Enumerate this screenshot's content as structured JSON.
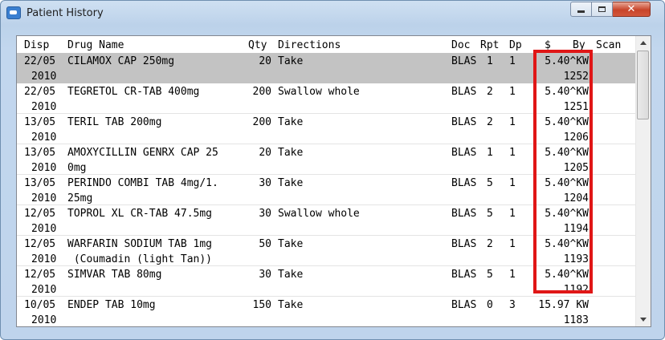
{
  "window": {
    "title": "Patient History",
    "icon": "app-icon",
    "controls": {
      "minimize": "minimize-icon",
      "maximize": "maximize-icon",
      "close_glyph": "✕"
    }
  },
  "table": {
    "headers": {
      "disp": "Disp",
      "drug": "Drug Name",
      "qty": "Qty",
      "directions": "Directions",
      "doc": "Doc",
      "rpt": "Rpt",
      "dp": "Dp",
      "price": "$",
      "by": "By",
      "scan": "Scan"
    },
    "rows": [
      {
        "date": "22/05",
        "year": "2010",
        "drug": "CILAMOX CAP 250mg",
        "drug2": "",
        "qty": "20",
        "directions": "Take",
        "doc": "BLAS",
        "rpt": "1",
        "dp": "1",
        "price_by": "5.40^KW",
        "scan": "1252",
        "selected": true
      },
      {
        "date": "22/05",
        "year": "2010",
        "drug": "TEGRETOL CR-TAB 400mg",
        "drug2": "",
        "qty": "200",
        "directions": "Swallow whole",
        "doc": "BLAS",
        "rpt": "2",
        "dp": "1",
        "price_by": "5.40^KW",
        "scan": "1251",
        "selected": false
      },
      {
        "date": "13/05",
        "year": "2010",
        "drug": "TERIL TAB 200mg",
        "drug2": "",
        "qty": "200",
        "directions": "Take",
        "doc": "BLAS",
        "rpt": "2",
        "dp": "1",
        "price_by": "5.40^KW",
        "scan": "1206",
        "selected": false
      },
      {
        "date": "13/05",
        "year": "2010",
        "drug": "AMOXYCILLIN GENRX CAP 25",
        "drug2": "0mg",
        "qty": "20",
        "directions": "Take",
        "doc": "BLAS",
        "rpt": "1",
        "dp": "1",
        "price_by": "5.40^KW",
        "scan": "1205",
        "selected": false
      },
      {
        "date": "13/05",
        "year": "2010",
        "drug": "PERINDO COMBI TAB 4mg/1.",
        "drug2": "25mg",
        "qty": "30",
        "directions": "Take",
        "doc": "BLAS",
        "rpt": "5",
        "dp": "1",
        "price_by": "5.40^KW",
        "scan": "1204",
        "selected": false
      },
      {
        "date": "12/05",
        "year": "2010",
        "drug": "TOPROL XL CR-TAB 47.5mg",
        "drug2": "",
        "qty": "30",
        "directions": "Swallow whole",
        "doc": "BLAS",
        "rpt": "5",
        "dp": "1",
        "price_by": "5.40^KW",
        "scan": "1194",
        "selected": false
      },
      {
        "date": "12/05",
        "year": "2010",
        "drug": "WARFARIN SODIUM TAB 1mg",
        "drug2": " (Coumadin (light Tan))",
        "qty": "50",
        "directions": "Take",
        "doc": "BLAS",
        "rpt": "2",
        "dp": "1",
        "price_by": "5.40^KW",
        "scan": "1193",
        "selected": false
      },
      {
        "date": "12/05",
        "year": "2010",
        "drug": "SIMVAR TAB 80mg",
        "drug2": "",
        "qty": "30",
        "directions": "Take",
        "doc": "BLAS",
        "rpt": "5",
        "dp": "1",
        "price_by": "5.40^KW",
        "scan": "1192",
        "selected": false
      },
      {
        "date": "10/05",
        "year": "2010",
        "drug": "ENDEP TAB 10mg",
        "drug2": "",
        "qty": "150",
        "directions": "Take",
        "doc": "BLAS",
        "rpt": "0",
        "dp": "3",
        "price_by": "15.97 KW",
        "scan": "1183",
        "selected": false
      }
    ]
  },
  "scrollbar": {
    "up_icon": "scroll-up-arrow-icon",
    "down_icon": "scroll-down-arrow-icon"
  },
  "highlight_color": "#e01616"
}
